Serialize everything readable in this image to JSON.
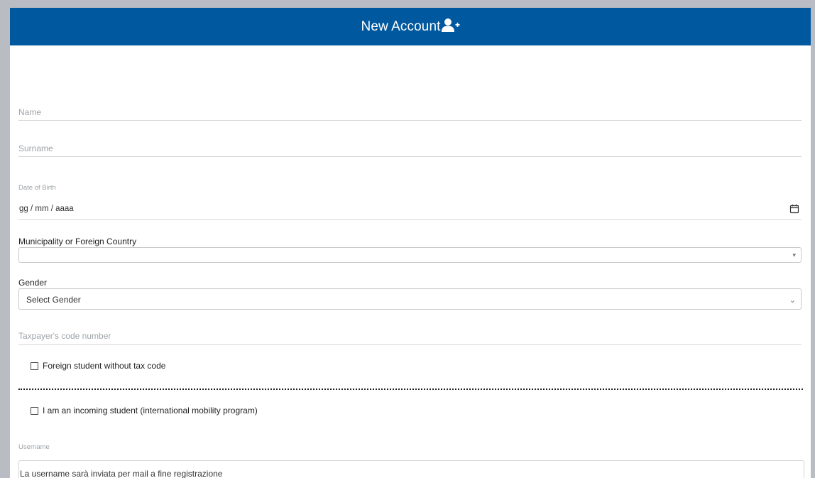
{
  "header": {
    "title": "New Account",
    "icon": "add-user-icon"
  },
  "form": {
    "name_placeholder": "Name",
    "surname_placeholder": "Surname",
    "dob_label": "Date of Birth",
    "dob_value": "gg / mm / aaaa",
    "municipality_label": "Municipality or Foreign Country",
    "municipality_value": "",
    "gender_label": "Gender",
    "gender_value": "Select Gender",
    "tax_placeholder": "Taxpayer's code number",
    "foreign_student_label": "Foreign student without tax code",
    "incoming_student_label": "I am an incoming student (international mobility program)",
    "username_label": "Username",
    "username_value": "La username sarà inviata per mail a fine registrazione"
  },
  "colors": {
    "header_bg": "#00589f",
    "header_text": "#ffffff",
    "page_bg": "#b9bcc2"
  }
}
